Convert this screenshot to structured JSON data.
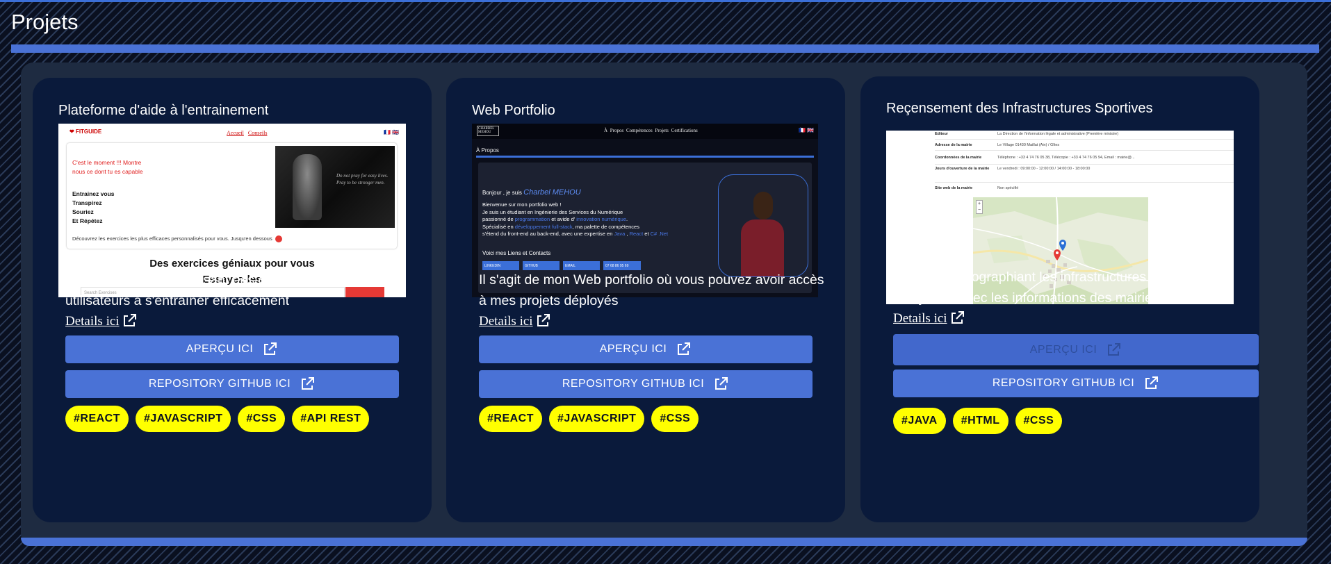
{
  "page": {
    "title": "Projets"
  },
  "projects": [
    {
      "title": "Plateforme d'aide à l'entrainement",
      "description": "Une application fournissant des conseils pour aider les utilisateurs à s'entraîner efficacement",
      "details_label": "Details ici",
      "preview_label": "APERÇU ICI",
      "preview_enabled": true,
      "repo_label": "REPOSITORY GITHUB ICI",
      "tags": [
        "#REACT",
        "#JAVASCRIPT",
        "#CSS",
        "#API REST"
      ],
      "screenshot": {
        "logo": "❤ FITGUIDE",
        "nav": [
          "Accueil",
          "Conseils"
        ],
        "flags": "🇫🇷 🇬🇧",
        "red_line_1": "C'est le moment !!! Montre",
        "red_line_2": "nous ce dont tu es capable",
        "list": [
          "Entrainez vous",
          "Transpirez",
          "Souriez",
          "Et Répétez"
        ],
        "quote_1": "Do not pray for easy lives.",
        "quote_2": "Pray to be stronger men.",
        "small": "Découvrez les exercices les plus efficaces personnalisés pour vous. Jusqu'en dessous",
        "heading_1": "Des exercices géniaux pour vous",
        "heading_2": "Essayez-les",
        "search_placeholder": "Search Exercises"
      }
    },
    {
      "title": "Web Portfolio",
      "description": "Il s'agit de mon Web portfolio où vous pouvez avoir accès à mes projets déployés",
      "details_label": "Details ici",
      "preview_label": "APERÇU ICI",
      "preview_enabled": true,
      "repo_label": "REPOSITORY GITHUB ICI",
      "tags": [
        "#REACT",
        "#JAVASCRIPT",
        "#CSS"
      ],
      "screenshot": {
        "logo": "CHARBEL MEHOU",
        "nav": "À Propos   Compétences   Projets   Certifications",
        "flags": "🇫🇷 🇬🇧",
        "section": "À Propos",
        "greeting": "Bonjour , je suis",
        "name": "Charbel MEHOU",
        "line_1": "Bienvenue sur mon portfolio web !",
        "line_2": "Je suis un étudiant en Ingénierie des Services du Numérique",
        "line_3a": "passionné de ",
        "line_3b": "programmation",
        "line_3c": " et avide d' ",
        "line_3d": "innovation numérique",
        "line_4a": "Spécialisé en ",
        "line_4b": "développement full-stack",
        "line_4c": ", ma palette de compétences",
        "line_5a": "s'étend du front-end au back-end, avec une expertise en ",
        "line_5b": "Java",
        "line_5c": " , ",
        "line_5d": "React",
        "line_5e": " et ",
        "line_5f": "C# .Net",
        "contacts": "Voici mes Liens et Contacts",
        "contact_buttons": [
          "LINKEDIN",
          "GITHUB",
          "EMAIL",
          "07 68 86 95 69"
        ]
      }
    },
    {
      "title": "Reçensement des Infrastructures Sportives",
      "description": "Site web cartographiant les infrastructures sportives françaises avec les informations des mairies associées",
      "details_label": "Details ici",
      "preview_label": "APERÇU ICI",
      "preview_enabled": false,
      "repo_label": "REPOSITORY GITHUB ICI",
      "tags": [
        "#JAVA",
        "#HTML",
        "#CSS"
      ],
      "screenshot": {
        "rows": [
          {
            "k": "Editeur",
            "v": "La Direction de l'information légale et administrative (Première ministre)"
          },
          {
            "k": "Adresse de la mairie",
            "v": "Le Village 01430 Maillat (Ain) / Gîtes"
          },
          {
            "k": "Coordonnées de la mairie",
            "v": "Téléphone : +33 4 74 76 05 38, Télécopie : +33 4 74 76 05 94, Email : mairie@..."
          },
          {
            "k": "Jours d'ouverture de la mairie",
            "v": "Le vendredi : 09:00:00 - 12:00:00 / 14:00:00 - 18:00:00"
          },
          {
            "k": "Site web de la mairie",
            "v": "Non spécifié"
          }
        ],
        "zoom_in": "+",
        "zoom_out": "−"
      }
    }
  ],
  "colors": {
    "accent": "#4a72d6",
    "tag": "#ffff00",
    "card": "#0a1a3b",
    "panel": "#1e2b41"
  }
}
